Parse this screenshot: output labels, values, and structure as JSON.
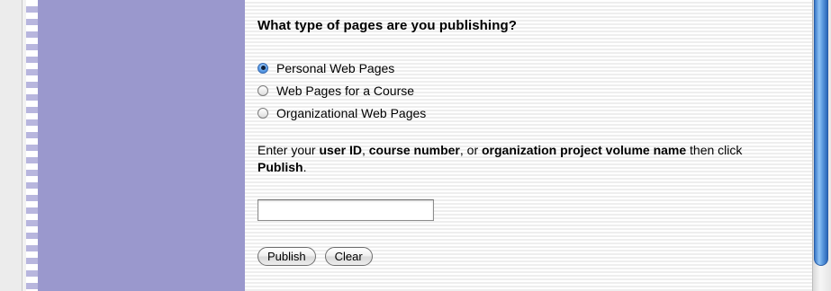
{
  "form": {
    "heading": "What type of pages are you publishing?",
    "options": [
      {
        "label": "Personal Web Pages",
        "selected": true
      },
      {
        "label": "Web Pages for a Course",
        "selected": false
      },
      {
        "label": "Organizational Web Pages",
        "selected": false
      }
    ],
    "instructions": {
      "t1": "Enter your ",
      "b1": "user ID",
      "t2": ", ",
      "b2": "course number",
      "t3": ", or ",
      "b3": "organization project volume name",
      "t4": " then click ",
      "b4": "Publish",
      "t5": "."
    },
    "input": {
      "value": "",
      "placeholder": ""
    },
    "publish_label": "Publish",
    "clear_label": "Clear"
  },
  "colors": {
    "sidebar": "#9a98cd",
    "accent": "#3d6fb3"
  }
}
